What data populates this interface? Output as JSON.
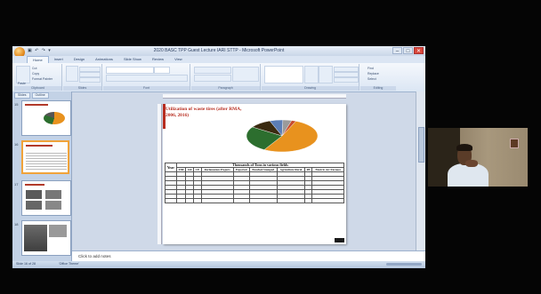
{
  "window": {
    "title": "2020 BASC TPP Guest Lecture IARI STTP - Microsoft PowerPoint",
    "qat_glyphs": "▣ ↶ ↷ ▾",
    "controls": [
      "–",
      "□",
      "✕"
    ]
  },
  "ribbon": {
    "tabs": [
      "Home",
      "Insert",
      "Design",
      "Animations",
      "Slide Show",
      "Review",
      "View"
    ],
    "groups": [
      "Clipboard",
      "Slides",
      "Font",
      "Paragraph",
      "Drawing",
      "Editing"
    ],
    "editing_items": [
      "Find",
      "Replace",
      "Select"
    ],
    "clipboard_items": [
      "Cut",
      "Copy",
      "Format Painter"
    ],
    "paste_label": "Paste"
  },
  "left_pane": {
    "tabs": [
      "Slides",
      "Outline"
    ],
    "slide_numbers": [
      "15",
      "16",
      "17",
      "18"
    ]
  },
  "slide": {
    "title": "Utilization of waste tires (after RMA, 2006, 2016)",
    "table": {
      "header_group": "Thousands of Tons in various fields",
      "columns": [
        "Year",
        "TDF",
        "GR",
        "CE",
        "Reclamation Projects",
        "Exported",
        "Punched Stamped",
        "Agriculture Rural",
        "RT",
        "Electric Arc Furnace"
      ]
    }
  },
  "chart_data": {
    "type": "pie",
    "title": "",
    "slices": [
      {
        "value": 52,
        "color": "#e8921e"
      },
      {
        "value": 26,
        "color": "#2c6e2e"
      },
      {
        "value": 10,
        "color": "#3a2a10"
      },
      {
        "value": 6,
        "color": "#5b7db6"
      },
      {
        "value": 4,
        "color": "#9a9a9a"
      },
      {
        "value": 2,
        "color": "#c84b2c"
      }
    ]
  },
  "notes": {
    "placeholder": "Click to add notes"
  },
  "status": {
    "slide_info": "Slide 16 of 28",
    "theme": "'Office Theme'"
  }
}
